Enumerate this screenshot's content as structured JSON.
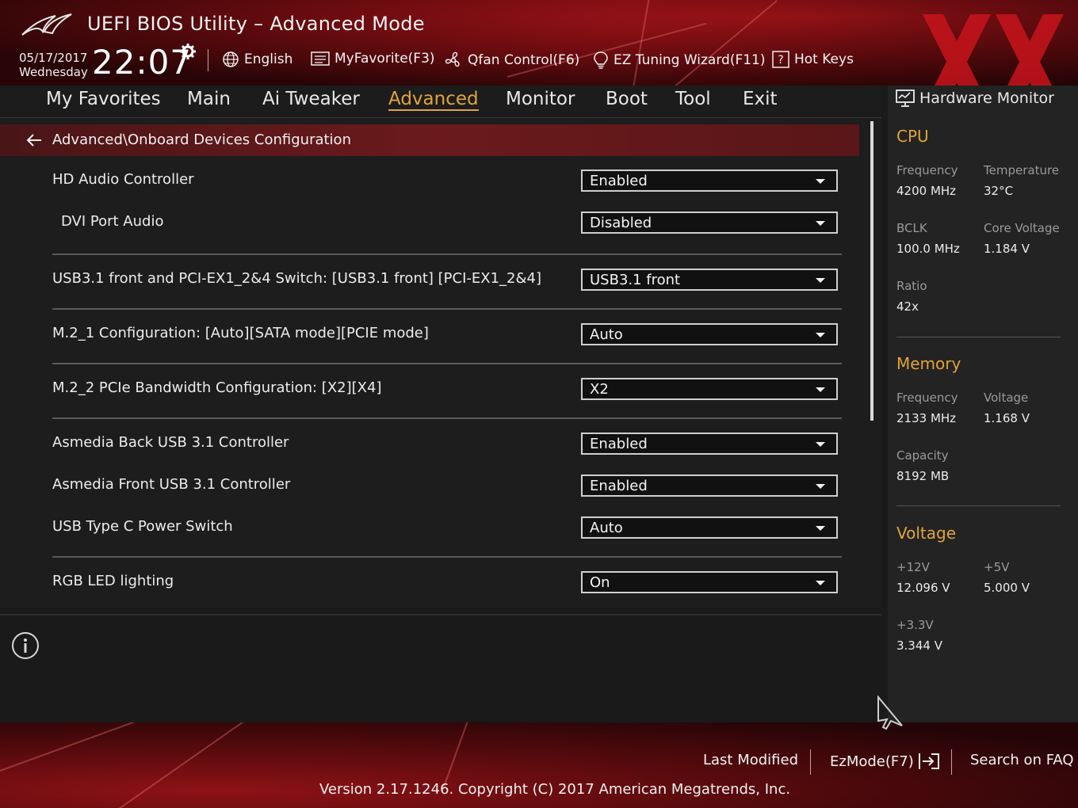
{
  "header": {
    "title": "UEFI BIOS Utility – Advanced Mode",
    "date": "05/17/2017",
    "day": "Wednesday",
    "time": "22:07",
    "tools": [
      {
        "label": "English",
        "icon": "globe-icon"
      },
      {
        "label": "MyFavorite(F3)",
        "icon": "favorite-list-icon"
      },
      {
        "label": "Qfan Control(F6)",
        "icon": "fan-icon"
      },
      {
        "label": "EZ Tuning Wizard(F11)",
        "icon": "lightbulb-icon"
      },
      {
        "label": "Hot Keys",
        "icon": "question-box-icon"
      }
    ]
  },
  "nav": {
    "tabs": [
      "My Favorites",
      "Main",
      "Ai Tweaker",
      "Advanced",
      "Monitor",
      "Boot",
      "Tool",
      "Exit"
    ],
    "active": "Advanced"
  },
  "breadcrumb": "Advanced\\Onboard Devices Configuration",
  "options": [
    {
      "label": "HD Audio Controller",
      "value": "Enabled"
    },
    {
      "label": "DVI Port Audio",
      "value": "Disabled"
    },
    {
      "label": "USB3.1 front and PCI-EX1_2&4 Switch: [USB3.1 front] [PCI-EX1_2&4]",
      "value": "USB3.1 front"
    },
    {
      "label": "M.2_1 Configuration: [Auto][SATA mode][PCIE mode]",
      "value": "Auto"
    },
    {
      "label": "M.2_2 PCIe Bandwidth Configuration: [X2][X4]",
      "value": "X2"
    },
    {
      "label": "Asmedia Back USB 3.1 Controller",
      "value": "Enabled"
    },
    {
      "label": "Asmedia Front USB 3.1 Controller",
      "value": "Enabled"
    },
    {
      "label": "USB Type C Power Switch",
      "value": "Auto"
    },
    {
      "label": "RGB LED lighting",
      "value": "On"
    }
  ],
  "hw_monitor": {
    "title": "Hardware Monitor",
    "cpu": {
      "section": "CPU",
      "freq_label": "Frequency",
      "freq": "4200 MHz",
      "temp_label": "Temperature",
      "temp": "32°C",
      "bclk_label": "BCLK",
      "bclk": "100.0 MHz",
      "vcore_label": "Core Voltage",
      "vcore": "1.184 V",
      "ratio_label": "Ratio",
      "ratio": "42x"
    },
    "memory": {
      "section": "Memory",
      "freq_label": "Frequency",
      "freq": "2133 MHz",
      "volt_label": "Voltage",
      "volt": "1.168 V",
      "cap_label": "Capacity",
      "cap": "8192 MB"
    },
    "voltage": {
      "section": "Voltage",
      "v12_label": "+12V",
      "v12": "12.096 V",
      "v5_label": "+5V",
      "v5": "5.000 V",
      "v33_label": "+3.3V",
      "v33": "3.344 V"
    }
  },
  "footer": {
    "last_modified": "Last Modified",
    "ezmode": "EzMode(F7)",
    "search_faq": "Search on FAQ",
    "version": "Version 2.17.1246. Copyright (C) 2017 American Megatrends, Inc."
  },
  "colors": {
    "accent": "#e0a43a",
    "brand_red": "#a8141a"
  }
}
